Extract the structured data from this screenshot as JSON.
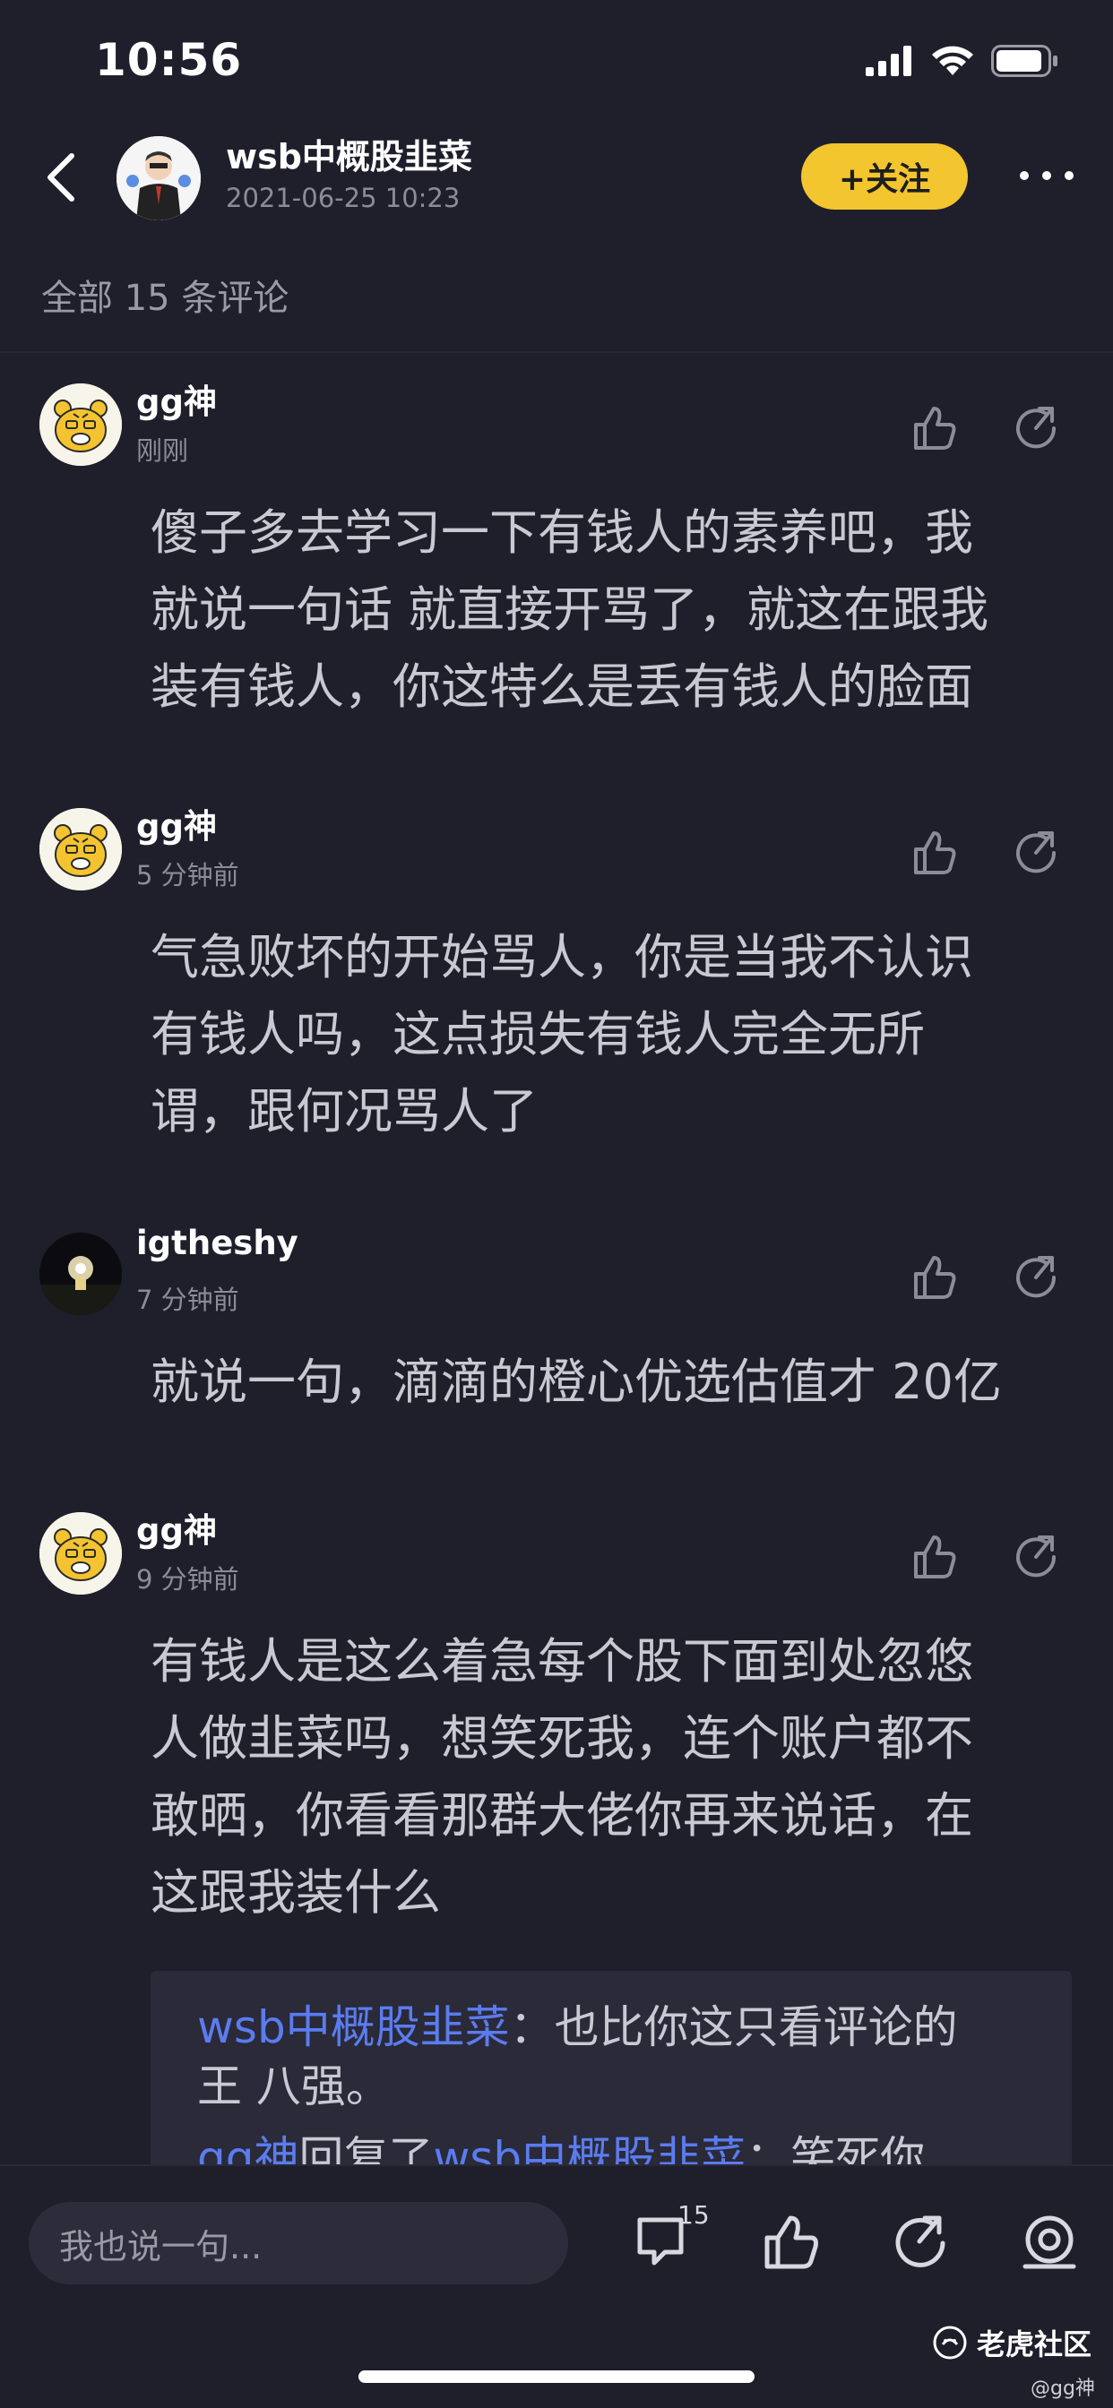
{
  "status_bar": {
    "time": "10:56"
  },
  "header": {
    "author": "wsb中概股韭菜",
    "timestamp": "2021-06-25 10:23",
    "follow_label": "+关注"
  },
  "comments_header": "全部 15 条评论",
  "comments": [
    {
      "name": "gg神",
      "time": "刚刚",
      "lines": [
        "傻子多去学习一下有钱人的素养吧，我",
        "就说一句话  就直接开骂了，就这在跟我",
        "装有钱人，你这特么是丢有钱人的脸面"
      ]
    },
    {
      "name": "gg神",
      "time": "5 分钟前",
      "lines": [
        "气急败坏的开始骂人，你是当我不认识",
        "有钱人吗，这点损失有钱人完全无所",
        "谓，跟何况骂人了"
      ]
    },
    {
      "name": "igtheshy",
      "time": "7 分钟前",
      "lines": [
        "就说一句，滴滴的橙心优选估值才 20亿"
      ]
    },
    {
      "name": "gg神",
      "time": "9 分钟前",
      "lines": [
        "有钱人是这么着急每个股下面到处忽悠",
        "人做韭菜吗，想笑死我，连个账户都不",
        "敢晒，你看看那群大佬你再来说话，在",
        "这跟我装什么"
      ]
    }
  ],
  "reply_box": {
    "reply1_user": "wsb中概股韭菜",
    "reply1_text_a": "：也比你这只看评论的",
    "reply1_text_b": "王 八强。",
    "reply2_user": "gg神",
    "reply2_mid": "回复了",
    "reply2_target": "wsb中概股韭菜",
    "reply2_text": "：笑死你"
  },
  "bottom_bar": {
    "input_placeholder": "我也说一句...",
    "comment_count": "15"
  },
  "watermark": {
    "brand": "老虎社区",
    "handle": "@gg神"
  },
  "colors": {
    "background": "#1f1f2b",
    "accent": "#f3c52e",
    "link": "#5b7cf0"
  }
}
